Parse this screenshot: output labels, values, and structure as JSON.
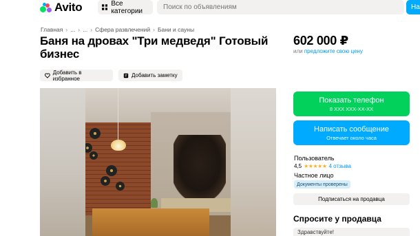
{
  "header": {
    "logo_text": "Avito",
    "categories_label": "Все категории",
    "search_placeholder": "Поиск по объявлениям",
    "find_label": "На"
  },
  "breadcrumbs": [
    "Главная",
    "...",
    "...",
    "Сфера развлечений",
    "Бани и сауны"
  ],
  "listing": {
    "title": "Баня на дровах \"Три медведя\" Готовый бизнес",
    "price": "602 000 ₽",
    "price_sub_prefix": "или",
    "price_sub_link": "предложите свою цену",
    "favorite_label": "Добавить в избранное",
    "note_label": "Добавить заметку"
  },
  "actions": {
    "phone_label": "Показать телефон",
    "phone_masked": "8 XXX XXX-XX-XX",
    "message_label": "Написать сообщение",
    "message_sub": "Отвечает около часа"
  },
  "seller": {
    "name": "Пользователь",
    "rating_value": "4,5",
    "stars": "★★★★★",
    "reviews": "4 отзыва",
    "type": "Частное лицо",
    "badge": "Документы проверены",
    "subscribe_label": "Подписаться на продавца"
  },
  "ask": {
    "title": "Спросите у продавца",
    "input_value": "Здравствуйте!"
  },
  "colors": {
    "green": "#02d15c",
    "blue": "#00aaff",
    "link": "#0099f7",
    "star": "#ffb021"
  }
}
